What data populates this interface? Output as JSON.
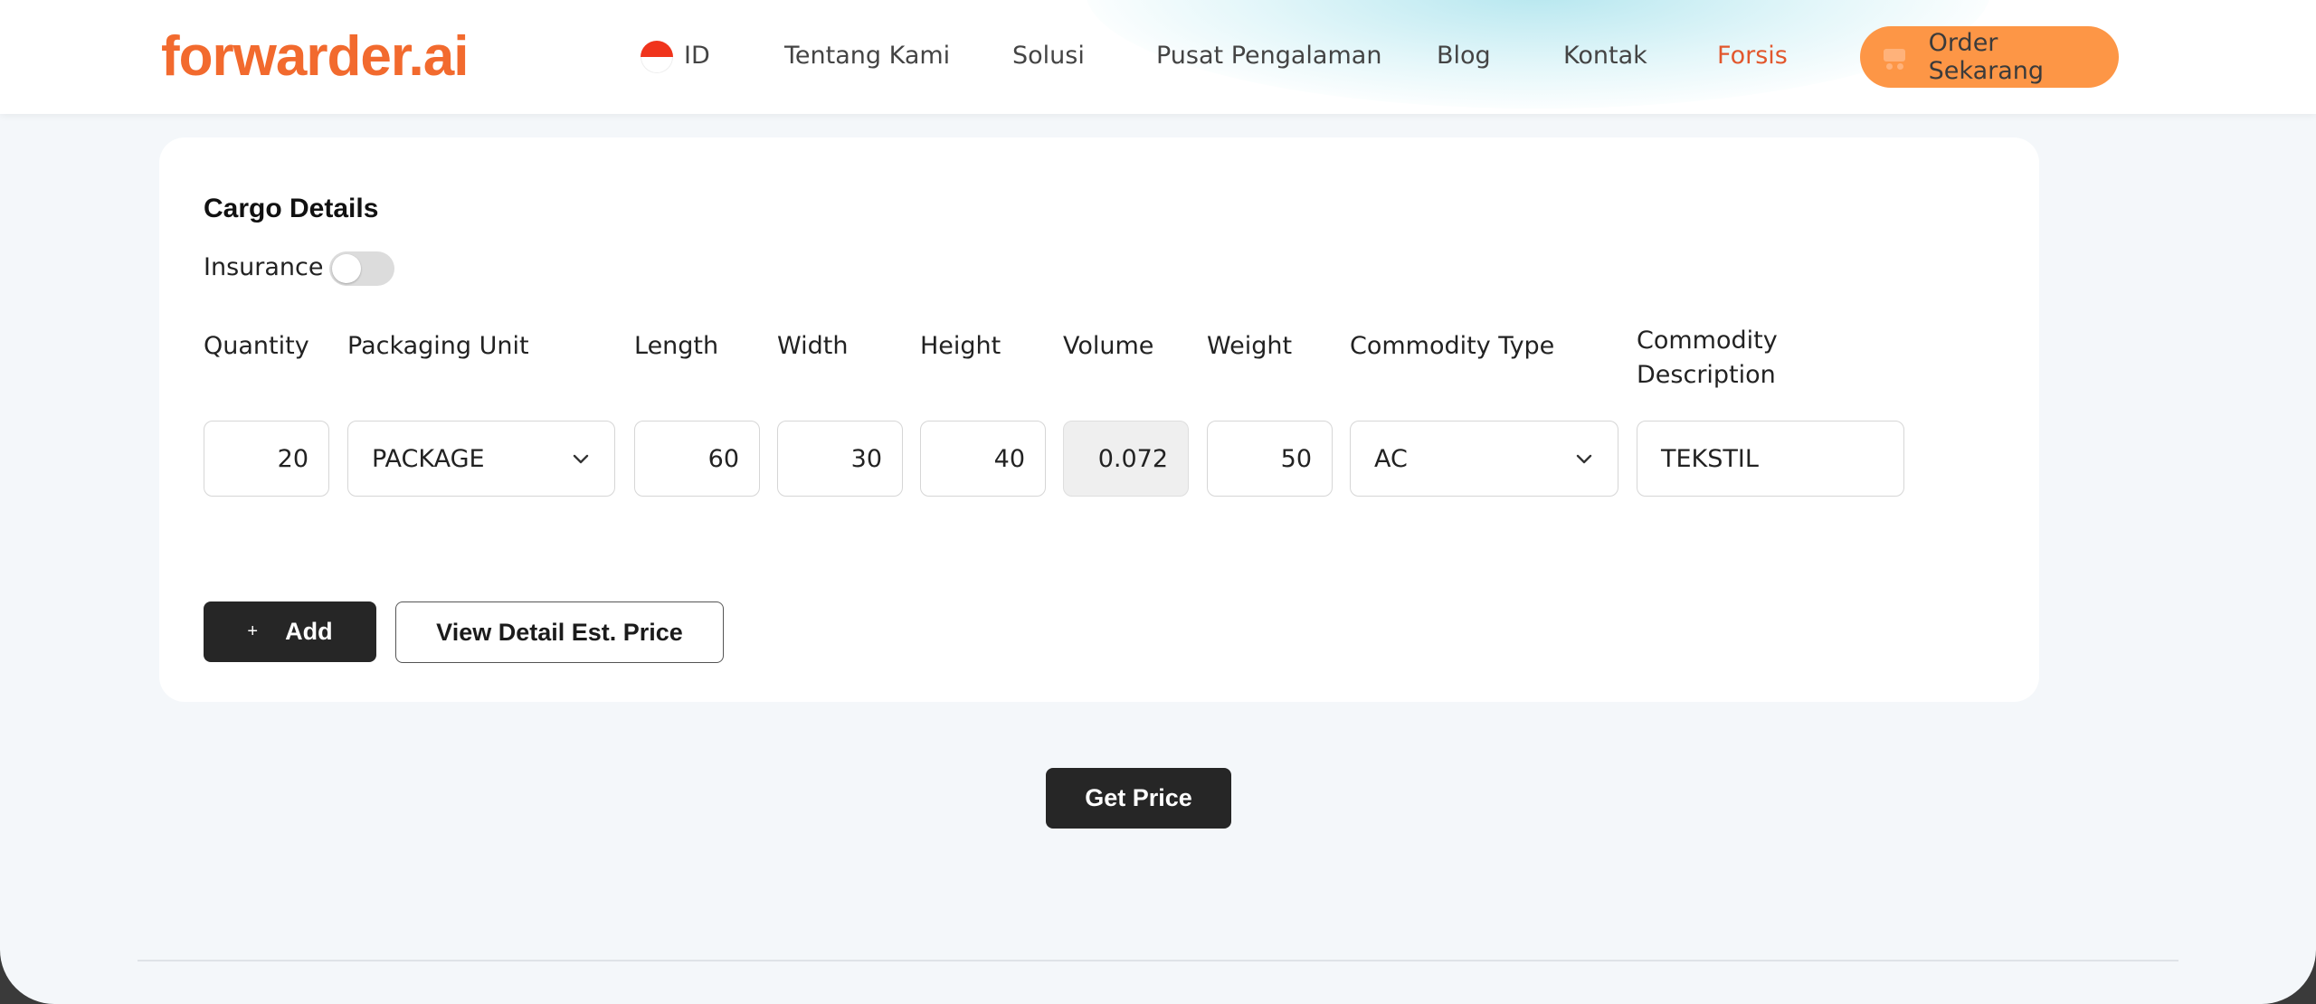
{
  "header": {
    "logo": "forwarder.ai",
    "language": "ID",
    "nav": [
      "Tentang Kami",
      "Solusi",
      "Pusat Pengalaman",
      "Blog",
      "Kontak",
      "Forsis"
    ],
    "active_nav": "Forsis",
    "order_button": "Order Sekarang"
  },
  "cargo": {
    "title": "Cargo Details",
    "insurance_label": "Insurance",
    "insurance_enabled": false,
    "columns": {
      "quantity": "Quantity",
      "packaging_unit": "Packaging Unit",
      "length": "Length",
      "width": "Width",
      "height": "Height",
      "volume": "Volume",
      "weight": "Weight",
      "commodity_type": "Commodity Type",
      "commodity_description_1": "Commodity",
      "commodity_description_2": "Description"
    },
    "row": {
      "quantity": "20",
      "packaging_unit": "PACKAGE",
      "length": "60",
      "width": "30",
      "height": "40",
      "volume": "0.072",
      "weight": "50",
      "commodity_type": "AC",
      "commodity_description": "TEKSTIL"
    },
    "add_button": "Add",
    "add_icon": "+",
    "detail_button": "View Detail Est. Price"
  },
  "get_price_button": "Get Price",
  "colors": {
    "brand_orange": "#f26a2e",
    "order_button": "#fd9646",
    "dark_button": "#262626",
    "active_nav": "#e2572d"
  }
}
